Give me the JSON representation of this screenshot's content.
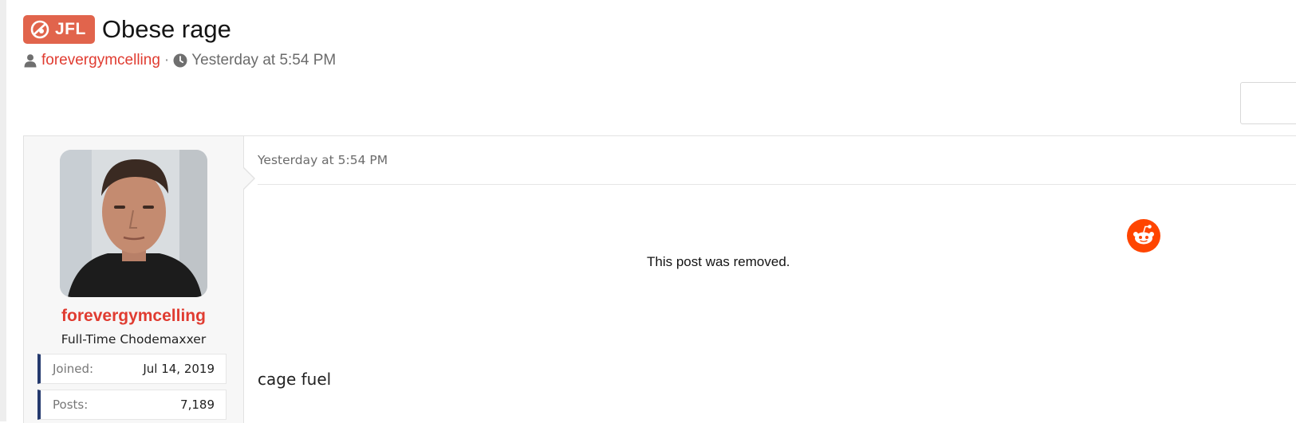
{
  "thread": {
    "prefix": "JFL",
    "title": "Obese rage",
    "author": "forevergymcelling",
    "separator": "·",
    "date": "Yesterday at 5:54 PM"
  },
  "post": {
    "user": {
      "name": "forevergymcelling",
      "title": "Full-Time Chodemaxxer",
      "stats": {
        "joined_label": "Joined:",
        "joined_value": "Jul 14, 2019",
        "posts_label": "Posts:",
        "posts_value": "7,189"
      }
    },
    "date": "Yesterday at 5:54 PM",
    "embed": {
      "removed_text": "This post was removed.",
      "icon": "reddit-icon"
    },
    "body": "cage fuel"
  },
  "colors": {
    "prefix_bg": "#e1644c",
    "accent_red": "#e03c31",
    "stat_border": "#253a6e",
    "reddit_orange": "#ff4500"
  }
}
